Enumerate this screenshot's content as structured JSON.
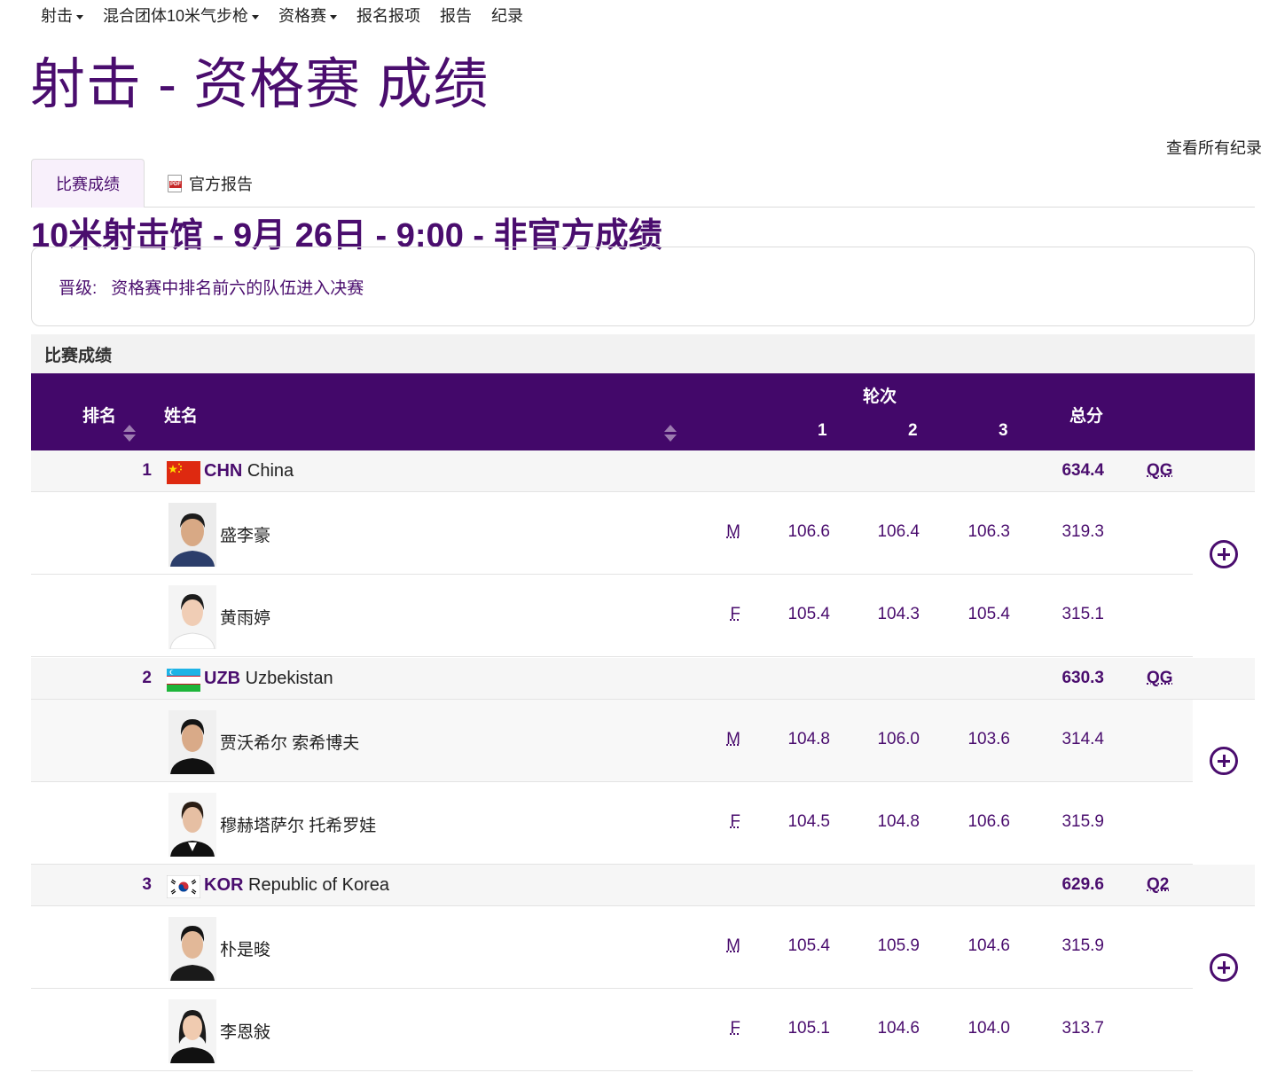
{
  "nav": {
    "items": [
      {
        "label": "射击",
        "dropdown": true
      },
      {
        "label": "混合团体10米气步枪",
        "dropdown": true
      },
      {
        "label": "资格赛",
        "dropdown": true
      },
      {
        "label": "报名报项",
        "dropdown": false
      },
      {
        "label": "报告",
        "dropdown": false
      },
      {
        "label": "纪录",
        "dropdown": false
      }
    ]
  },
  "page_title": "射击 - 资格赛 成绩",
  "all_records_link": "查看所有纪录",
  "tabs": {
    "results": "比赛成绩",
    "official_report": "官方报告"
  },
  "session_title": "10米射击馆 - 9月 26日 - 9:00 - 非官方成绩",
  "qualification": {
    "label": "晋级:",
    "text": "资格赛中排名前六的队伍进入决赛"
  },
  "section_header": "比赛成绩",
  "table_header": {
    "rank": "排名",
    "name": "姓名",
    "rounds": "轮次",
    "round1": "1",
    "round2": "2",
    "round3": "3",
    "total": "总分"
  },
  "teams": [
    {
      "rank": "1",
      "noc": "CHN",
      "country": "China",
      "flag": "china-flag",
      "total": "634.4",
      "qualification_mark": "QG",
      "athletes": [
        {
          "name": "盛李豪",
          "gender": "M",
          "r1": "106.6",
          "r2": "106.4",
          "r3": "106.3",
          "total": "319.3"
        },
        {
          "name": "黄雨婷",
          "gender": "F",
          "r1": "105.4",
          "r2": "104.3",
          "r3": "105.4",
          "total": "315.1"
        }
      ]
    },
    {
      "rank": "2",
      "noc": "UZB",
      "country": "Uzbekistan",
      "flag": "uzbekistan-flag",
      "total": "630.3",
      "qualification_mark": "QG",
      "athletes": [
        {
          "name": "贾沃希尔 索希博夫",
          "gender": "M",
          "r1": "104.8",
          "r2": "106.0",
          "r3": "103.6",
          "total": "314.4"
        },
        {
          "name": "穆赫塔萨尔 托希罗娃",
          "gender": "F",
          "r1": "104.5",
          "r2": "104.8",
          "r3": "106.6",
          "total": "315.9"
        }
      ]
    },
    {
      "rank": "3",
      "noc": "KOR",
      "country": "Republic of Korea",
      "flag": "korea-flag",
      "total": "629.6",
      "qualification_mark": "Q2",
      "athletes": [
        {
          "name": "朴是晙",
          "gender": "M",
          "r1": "105.4",
          "r2": "105.9",
          "r3": "104.6",
          "total": "315.9"
        },
        {
          "name": "李恩敍",
          "gender": "F",
          "r1": "105.1",
          "r2": "104.6",
          "r3": "104.0",
          "total": "313.7"
        }
      ]
    }
  ],
  "colors": {
    "brand_purple": "#4a0d6e",
    "header_bg": "#43086a",
    "team_row_bg": "#f6f6f6"
  }
}
